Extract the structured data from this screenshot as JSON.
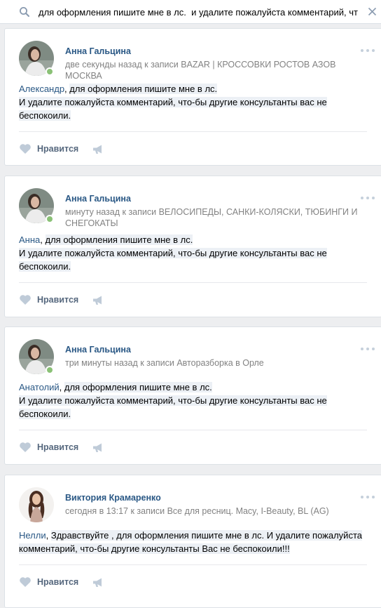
{
  "search": {
    "query": "для оформления пишите мне в лс.  и удалите пожалуйста комментарий, чт"
  },
  "colors": {
    "link": "#2a5885",
    "meta": "#828282",
    "highlight": "#ecf0f5",
    "online": "#8ac176"
  },
  "posts": [
    {
      "author": "Анна Гальцина",
      "time": "две секунды назад",
      "to_post": "к записи",
      "post_title": "BAZAR | КРОССОВКИ РОСТОВ АЗОВ МОСКВА",
      "mention": "Александр",
      "line1": "для оформления пишите мне в лс.",
      "line2": "И удалите пожалуйста комментарий, что-бы другие консультанты вас не",
      "line3": "беспокоили.",
      "like_label": "Нравится",
      "online": true
    },
    {
      "author": "Анна Гальцина",
      "time": "минуту назад",
      "to_post": "к записи",
      "post_title": "ВЕЛОСИПЕДЫ, САНКИ-КОЛЯСКИ, ТЮБИНГИ И СНЕГОКАТЫ",
      "mention": "Анна",
      "line1": "для оформления пишите мне в лс.",
      "line2": "И удалите пожалуйста комментарий, что-бы другие консультанты вас не",
      "line3": "беспокоили.",
      "like_label": "Нравится",
      "online": true
    },
    {
      "author": "Анна Гальцина",
      "time": "три минуты назад",
      "to_post": "к записи",
      "post_title": "Авторазборка в Орле",
      "mention": "Анатолий",
      "line1": "для оформления пишите мне в лс.",
      "line2": "И удалите пожалуйста комментарий, что-бы другие консультанты вас не",
      "line3": "беспокоили.",
      "like_label": "Нравится",
      "online": true
    },
    {
      "author": "Виктория Крамаренко",
      "time": "сегодня в 13:17",
      "to_post": "к записи",
      "post_title": "Все для ресниц. Macy, I-Beauty, BL (AG)",
      "mention": "Нелли",
      "line1": "Здравствуйте , для оформления пишите мне в лс. И удалите пожалуйста",
      "line2": "комментарий, что-бы другие консультанты Вас не беспокоили!!!",
      "like_label": "Нравится",
      "online": false
    }
  ]
}
